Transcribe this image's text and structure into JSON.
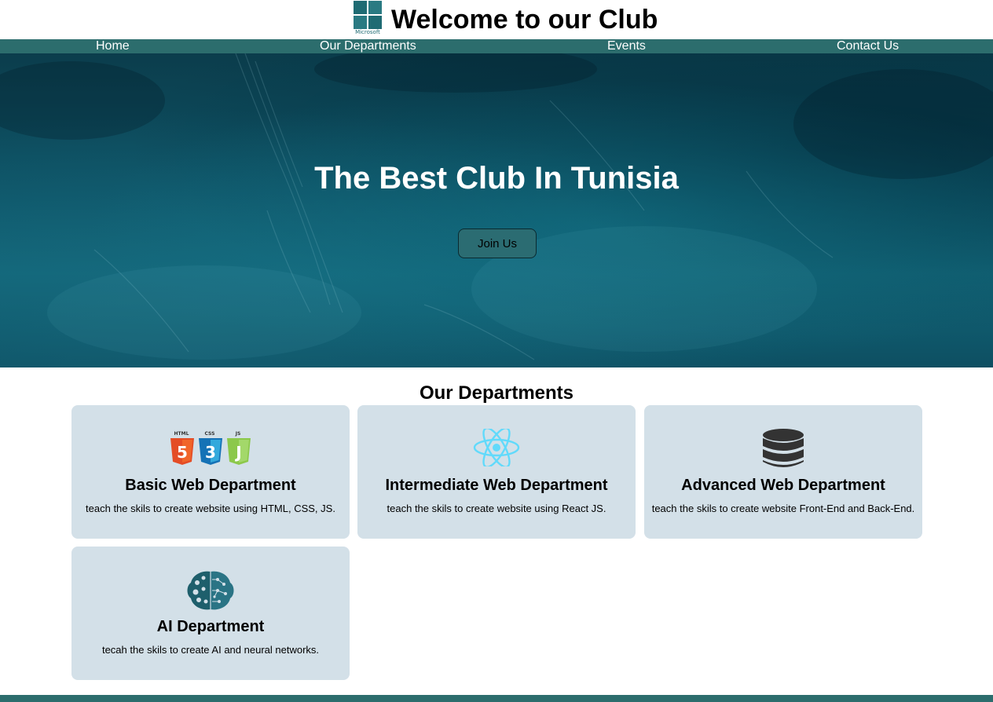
{
  "header": {
    "logo_text": "Microsoft",
    "title": "Welcome to our Club"
  },
  "nav": {
    "items": [
      {
        "label": "Home"
      },
      {
        "label": "Our Departments"
      },
      {
        "label": "Events"
      },
      {
        "label": "Contact Us"
      }
    ]
  },
  "hero": {
    "title": "The Best Club In Tunisia",
    "button_label": "Join Us"
  },
  "departments": {
    "title": "Our Departments",
    "cards": [
      {
        "title": "Basic Web Department",
        "description": "teach the skils to create website using HTML, CSS, JS.",
        "icon": "html-css-js-icon"
      },
      {
        "title": "Intermediate Web Department",
        "description": "teach the skils to create website using React JS.",
        "icon": "react-icon"
      },
      {
        "title": "Advanced Web Department",
        "description": "teach the skils to create website Front-End and Back-End.",
        "icon": "database-icon"
      },
      {
        "title": "AI Department",
        "description": "tecah the skils to create AI and neural networks.",
        "icon": "brain-icon"
      }
    ]
  },
  "colors": {
    "nav_background": "#2c6d6d",
    "card_background": "#d3e0e8",
    "button_background": "#2b6c72"
  }
}
